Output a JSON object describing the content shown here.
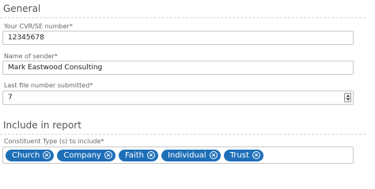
{
  "general": {
    "title": "General",
    "cvr_label": "Your CVR/SE number*",
    "cvr_value": "12345678",
    "sender_label": "Name of sender*",
    "sender_value": "Mark Eastwood Consulting",
    "file_label": "Last file number submitted*",
    "file_value": "7"
  },
  "report": {
    "title": "Include in report",
    "constituent_label": "Constituent Type (s) to include*",
    "tags": [
      {
        "label": "Church"
      },
      {
        "label": "Company"
      },
      {
        "label": "Faith"
      },
      {
        "label": "Individual"
      },
      {
        "label": "Trust"
      }
    ],
    "tag_color": "#1e6fb8"
  }
}
